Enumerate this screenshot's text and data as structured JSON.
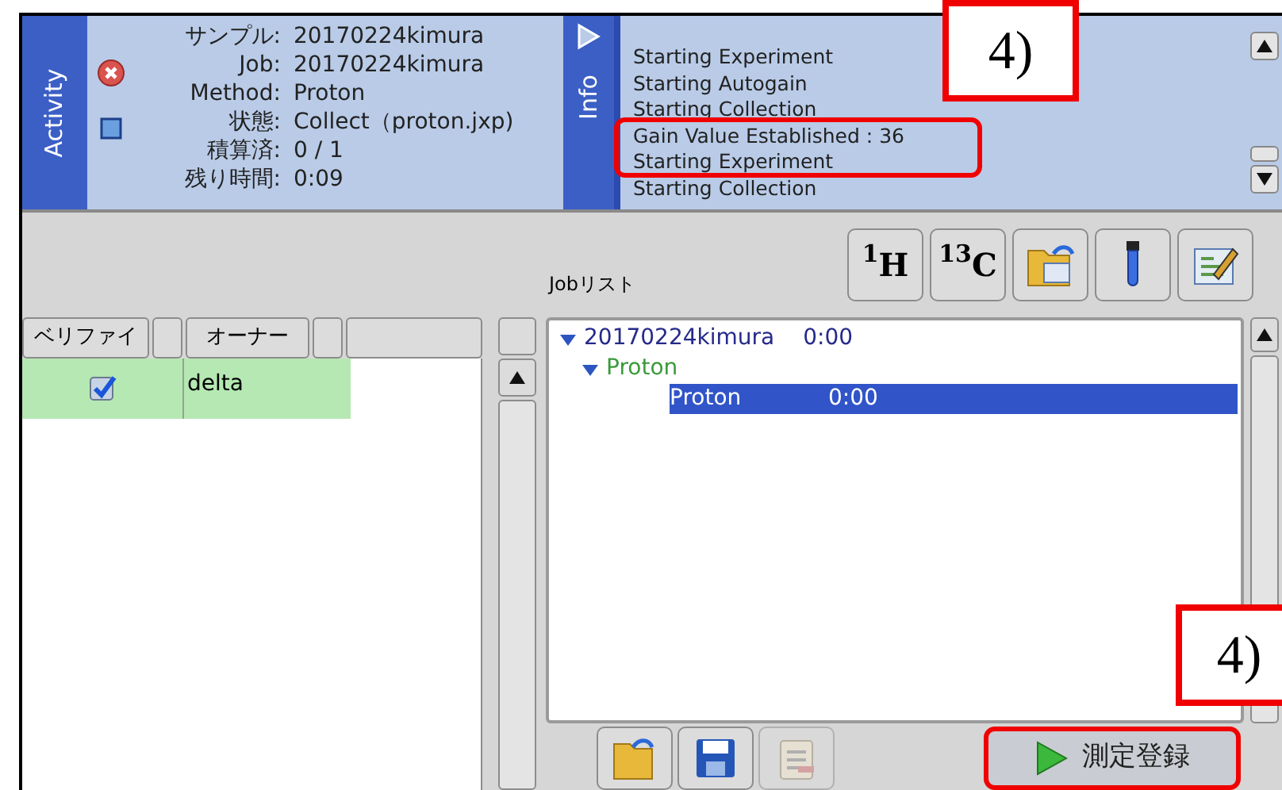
{
  "activity": {
    "tab": "Activity",
    "fields": [
      {
        "label": "サンプル:",
        "value": "20170224kimura"
      },
      {
        "label": "Job:",
        "value": "20170224kimura"
      },
      {
        "label": "Method:",
        "value": "Proton"
      },
      {
        "label": "状態:",
        "value": "Collect（proton.jxp)"
      },
      {
        "label": "積算済:",
        "value": "0 / 1"
      },
      {
        "label": "残り時間:",
        "value": "0:09"
      }
    ]
  },
  "info": {
    "tab": "Info",
    "log": [
      "Starting Experiment",
      "Starting Autogain",
      "Starting Collection",
      "Gain Value Established : 36",
      "Starting Experiment",
      "Starting Collection"
    ]
  },
  "table": {
    "columns": [
      "ベリファイ",
      "",
      "オーナー",
      "",
      ""
    ],
    "rows": [
      {
        "verified": true,
        "owner": "delta",
        "selected": true
      }
    ]
  },
  "job_list": {
    "label": "Jobリスト",
    "tree": [
      {
        "label": "20170224kimura",
        "time": "0:00",
        "expanded": true,
        "selected": false,
        "children": [
          {
            "label": "Proton",
            "expanded": true,
            "selected": false,
            "children": [
              {
                "label": "Proton",
                "time": "0:00",
                "selected": true
              }
            ]
          }
        ]
      }
    ]
  },
  "toolbar": [
    {
      "label": "$^{1}$H"
    },
    {
      "label": "$^{13}$C"
    }
  ],
  "bottom_buttons": [
    {
      "disabled": false
    },
    {
      "disabled": false
    },
    {
      "disabled": true
    }
  ],
  "register_button": {
    "label": "測定登録"
  },
  "annotations": [
    {
      "label": "4)"
    },
    {
      "label": "4)"
    }
  ]
}
